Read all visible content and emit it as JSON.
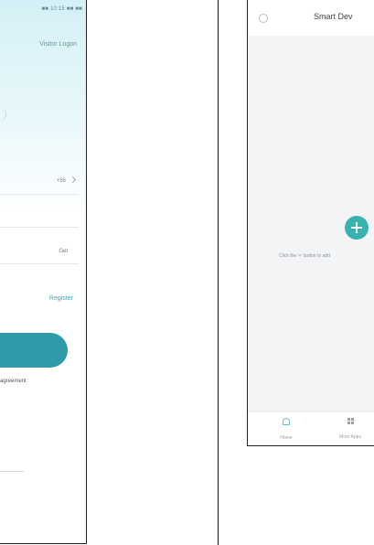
{
  "left_screen": {
    "status_bar_text": "■■ 10:15 ■■ ■■",
    "visitor_logon_label": "Visitor Logon",
    "region_value": "+86",
    "get_code_label": "Get",
    "register_label": "Register",
    "agreement_text": "agreement",
    "colors": {
      "accent": "#2f9aa8",
      "gradient_top": "#d4f0f6"
    }
  },
  "right_screen": {
    "status_text": "",
    "header_title": "Smart Dev",
    "empty_hint": "Click the '+' button to add",
    "tabs": [
      {
        "label": "Home",
        "icon": "home-icon"
      },
      {
        "label": "More Apps",
        "icon": "grid-icon"
      }
    ],
    "colors": {
      "accent": "#37b4b0",
      "background": "#f3f4f6"
    }
  }
}
